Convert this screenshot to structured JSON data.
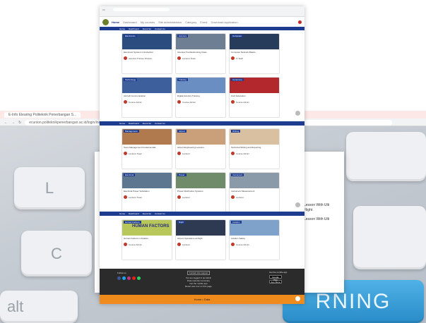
{
  "back_window": {
    "tab_label": "E-Info Elearing Politeknik Penerbangan S...",
    "url": "ecunion.politeknikpenerbangan.ac.id/login/index.php"
  },
  "keys": {
    "l": "L",
    "c": "C",
    "alt": "alt",
    "learning": "RNING"
  },
  "modal": {
    "line1": "Lesson With Ulti",
    "line2": "Flight",
    "line3": "Lesson With Ulti"
  },
  "page": {
    "header_nav": [
      "Home",
      "Dashboard",
      "My courses",
      "Site administration",
      "Category",
      "Event",
      "Download application"
    ],
    "nav": [
      "Home",
      "Dashboard",
      "Event list",
      "Contact Us"
    ],
    "cards": [
      {
        "tag": "Electronics",
        "title": "Electronic Systems Introduction",
        "author": "Avionics Trainee Division",
        "color": "#2b4c7e"
      },
      {
        "tag": "Avionics",
        "title": "Avionics Troubleshooting Class",
        "author": "Lecturer Team",
        "color": "#6f7f93"
      },
      {
        "tag": "Computer",
        "title": "Computer Network Basics",
        "author": "IT Staff",
        "color": "#263c5a"
      },
      {
        "tag": "Technology",
        "title": "Aircraft Communication",
        "author": "Course Admin",
        "color": "#3d5f9c"
      },
      {
        "tag": "Training",
        "title": "Digital Avionics Training",
        "author": "Course Admin",
        "color": "#6b8ec2"
      },
      {
        "tag": "Ceremony",
        "title": "Civic Education",
        "author": "Course Admin",
        "color": "#b3282d"
      },
      {
        "tag": "Management",
        "title": "Team Management Fundamentals",
        "author": "Lecturer Team",
        "color": "#b07a4e"
      },
      {
        "tag": "Airport",
        "title": "Airport Engineering Lessons",
        "author": "Lecturer",
        "color": "#c9a079"
      },
      {
        "tag": "Writing",
        "title": "Technical Writing and Reporting",
        "author": "Course Admin",
        "color": "#d9c0a0"
      },
      {
        "tag": "Electrical",
        "title": "Electrical Power Substation",
        "author": "Lecturer Team",
        "color": "#5e7790"
      },
      {
        "tag": "Power",
        "title": "Power Distribution Systems",
        "author": "Lecturer",
        "color": "#6f8b6a"
      },
      {
        "tag": "Instrument",
        "title": "Instrument Measurement",
        "author": "Lecturer",
        "color": "#8a9aa8"
      },
      {
        "tag": "Human Factors",
        "title": "Human Factors in Aviation",
        "author": "Course Admin",
        "color": "#b7c75a"
      },
      {
        "tag": "Night",
        "title": "Airport Operations at Night",
        "author": "Lecturer",
        "color": "#2d3a52"
      },
      {
        "tag": "Aviation",
        "title": "Aviation Safety",
        "author": "Course Admin",
        "color": "#7ea2c9"
      }
    ],
    "human_factors_text": "HUMAN FACTORS",
    "footer": {
      "follow": "Follow us",
      "contact_title": "Contact site support",
      "contact_lines": [
        "You are logged in as Admin",
        "Data retention summary",
        "Get the mobile app",
        "Reset user tour on this page"
      ],
      "app_title": "Get the mobile app",
      "store1": "Google Play",
      "store2": "App Store",
      "bar_text": "Home • Data"
    },
    "colors": {
      "nav": "#1d3c8f",
      "footer": "#2b2b2b",
      "bar": "#ef8a1c"
    }
  }
}
